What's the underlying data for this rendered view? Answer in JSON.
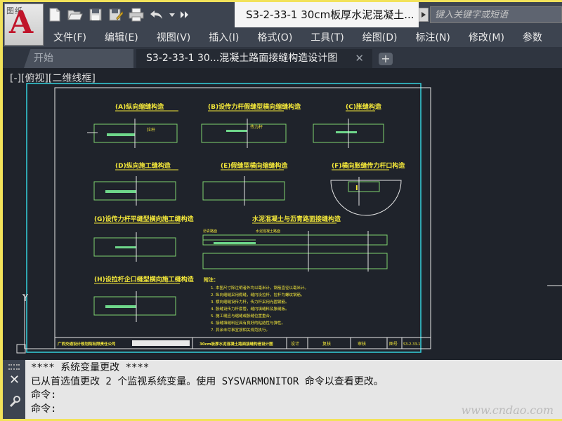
{
  "app": {
    "logo_text": "图纸",
    "logo_letter": "A",
    "document_title": "S3-2-33-1 30cm板厚水泥混凝土...",
    "search_placeholder": "键入关键字或短语"
  },
  "quick_access": [
    "new-icon",
    "open-icon",
    "save-icon",
    "save-as-icon",
    "plot-icon",
    "undo-icon",
    "dropdown-icon",
    "more-icon"
  ],
  "menu": {
    "items": [
      "文件(F)",
      "编辑(E)",
      "视图(V)",
      "插入(I)",
      "格式(O)",
      "工具(T)",
      "绘图(D)",
      "标注(N)",
      "修改(M)",
      "参数"
    ]
  },
  "tabs": {
    "start_label": "开始",
    "doc_label": "S3-2-33-1 30...混凝土路面接缝构造设计图",
    "close_glyph": "✕",
    "add_glyph": "+"
  },
  "viewport": {
    "label": "[-][俯视][二维线框]"
  },
  "drawing": {
    "colors": {
      "frame": "#35d1dd",
      "border": "#e8e8e8",
      "line": "#7fd36f",
      "title": "#f3e73a",
      "hatch": "#6ed68a"
    },
    "section_titles": [
      "(A)纵向缩缝构造",
      "(B)设传力杆假缝型横向缩缝构造",
      "(C)胀缝构造",
      "(D)纵向施工缝构造",
      "(E)假缝型横向缩缝构造",
      "(F)横向胀缝传力杆口构造",
      "(G)设传力杆平缝型横向施工缝构造",
      "水泥混凝土与沥青路面接缝构造",
      "(H)设拉杆企口缝型横向施工缝构造"
    ],
    "notes_heading": "附注：",
    "notes": [
      "1. 本图尺寸除注明者外均以毫米计，钢筋直径以毫米计。",
      "2. 纵向缩缝采用假缝，缝内设拉杆，拉杆为螺纹钢筋。",
      "3. 横向缩缝设传力杆，传力杆采用光圆钢筋。",
      "4. 胀缝设传力杆套管，缝内填缝料及胀缝板。",
      "5. 施工缝应与缩缝或胀缝位置重合。",
      "6. 接缝填缝料应具有良好的粘结性与弹性。",
      "7. 其余未尽事宜按相关规范执行。"
    ],
    "title_block": {
      "company": "广西交通设计规划院有限责任公司",
      "drawing_name": "30cm板厚水泥混凝土路面接缝构造设计图",
      "design_label": "设计",
      "review_label": "复核",
      "approve_label": "审核",
      "sheet_label": "图号",
      "sheet_no": "S3-2-33-1"
    }
  },
  "command": {
    "lines": [
      "**** 系统变量更改 ****",
      "已从首选值更改 2 个监视系统变量。使用 SYSVARMONITOR 命令以查看更改。",
      "命令:",
      "命令:"
    ],
    "close_glyph": "✕"
  },
  "watermark": "www.cndao.com"
}
